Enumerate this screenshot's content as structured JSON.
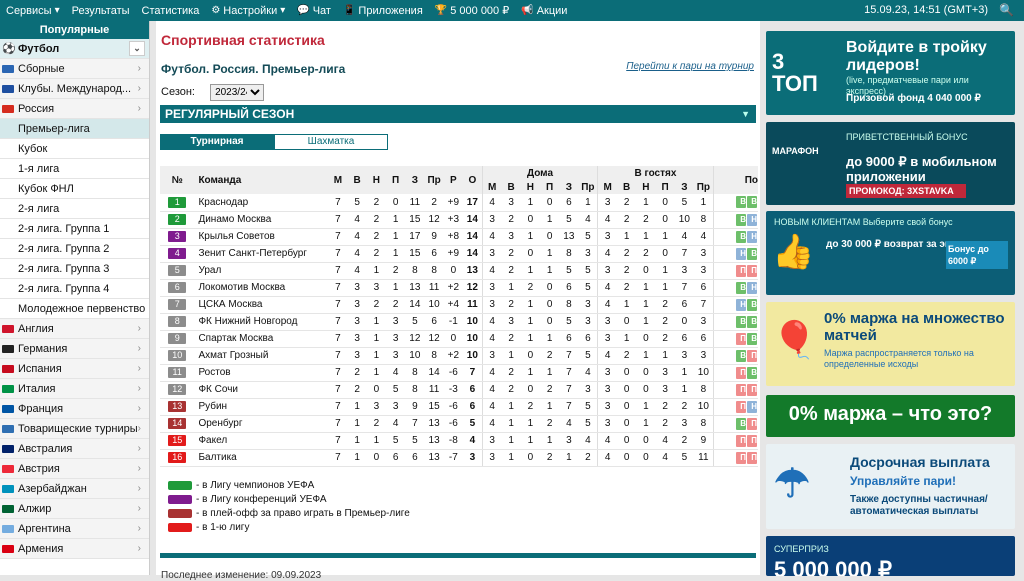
{
  "topbar": {
    "items": [
      {
        "label": "Сервисы",
        "icon": "",
        "dd": true
      },
      {
        "label": "Результаты",
        "icon": ""
      },
      {
        "label": "Статистика",
        "icon": ""
      },
      {
        "label": "Настройки",
        "icon": "gear",
        "dd": true
      },
      {
        "label": "Чат",
        "icon": "chat"
      },
      {
        "label": "Приложения",
        "icon": "phone"
      },
      {
        "label": "5 000 000 ₽",
        "icon": "trophy"
      },
      {
        "label": "Акции",
        "icon": "megaphone"
      }
    ],
    "datetime": "15.09.23, 14:51 (GMT+3)"
  },
  "sidebar": {
    "header": "Популярные",
    "items": [
      {
        "label": "Футбол",
        "type": "top",
        "sel": true,
        "flag": "ball"
      },
      {
        "label": "Сборные",
        "type": "top",
        "flag": "#2b66b3"
      },
      {
        "label": "Клубы. Международ...",
        "type": "top",
        "flag": "#1e4fa0"
      },
      {
        "label": "Россия",
        "type": "top",
        "flag": "#d52b1e"
      },
      {
        "label": "Премьер-лига",
        "type": "sub",
        "sel": true
      },
      {
        "label": "Кубок",
        "type": "sub"
      },
      {
        "label": "1-я лига",
        "type": "sub"
      },
      {
        "label": "Кубок ФНЛ",
        "type": "sub"
      },
      {
        "label": "2-я лига",
        "type": "sub"
      },
      {
        "label": "2-я лига. Группа 1",
        "type": "sub"
      },
      {
        "label": "2-я лига. Группа 2",
        "type": "sub"
      },
      {
        "label": "2-я лига. Группа 3",
        "type": "sub"
      },
      {
        "label": "2-я лига. Группа 4",
        "type": "sub"
      },
      {
        "label": "Молодежное первенство",
        "type": "sub"
      },
      {
        "label": "Англия",
        "type": "top",
        "flag": "#cf142b"
      },
      {
        "label": "Германия",
        "type": "top",
        "flag": "#222"
      },
      {
        "label": "Испания",
        "type": "top",
        "flag": "#c60b1e"
      },
      {
        "label": "Италия",
        "type": "top",
        "flag": "#009246"
      },
      {
        "label": "Франция",
        "type": "top",
        "flag": "#0055a4"
      },
      {
        "label": "Товарищеские турниры",
        "type": "top",
        "flag": "#2f6fb2"
      },
      {
        "label": "Австралия",
        "type": "top",
        "flag": "#012169"
      },
      {
        "label": "Австрия",
        "type": "top",
        "flag": "#ed2939"
      },
      {
        "label": "Азербайджан",
        "type": "top",
        "flag": "#0092bc"
      },
      {
        "label": "Алжир",
        "type": "top",
        "flag": "#006233"
      },
      {
        "label": "Аргентина",
        "type": "top",
        "flag": "#74acdf"
      },
      {
        "label": "Армения",
        "type": "top",
        "flag": "#d90012"
      }
    ]
  },
  "main": {
    "title": "Спортивная статистика",
    "subtitle": "Футбол. Россия. Премьер-лига",
    "link": "Перейти к пари на турнир",
    "season_label": "Сезон:",
    "season_value": "2023/24",
    "band": "РЕГУЛЯРНЫЙ СЕЗОН",
    "tabs": [
      "Турнирная таблица",
      "Шахматка"
    ],
    "headers": {
      "no": "№",
      "team": "Команда",
      "cols": [
        "М",
        "В",
        "Н",
        "П",
        "З",
        "Пр",
        "Р",
        "О"
      ],
      "home": "Дома",
      "away": "В гостях",
      "sub": [
        "М",
        "В",
        "Н",
        "П",
        "З",
        "Пр"
      ],
      "form": "По"
    },
    "rows": [
      {
        "n": "1",
        "c": "g",
        "team": "Краснодар",
        "s": [
          "7",
          "5",
          "2",
          "0",
          "11",
          "2",
          "+9",
          "17"
        ],
        "h": [
          "4",
          "3",
          "1",
          "0",
          "6",
          "1"
        ],
        "a": [
          "3",
          "2",
          "1",
          "0",
          "5",
          "1"
        ],
        "f": [
          "В",
          "В"
        ]
      },
      {
        "n": "2",
        "c": "g",
        "team": "Динамо Москва",
        "s": [
          "7",
          "4",
          "2",
          "1",
          "15",
          "12",
          "+3",
          "14"
        ],
        "h": [
          "3",
          "2",
          "0",
          "1",
          "5",
          "4"
        ],
        "a": [
          "4",
          "2",
          "2",
          "0",
          "10",
          "8"
        ],
        "f": [
          "В",
          "Н"
        ]
      },
      {
        "n": "3",
        "c": "v",
        "team": "Крылья Советов",
        "s": [
          "7",
          "4",
          "2",
          "1",
          "17",
          "9",
          "+8",
          "14"
        ],
        "h": [
          "4",
          "3",
          "1",
          "0",
          "13",
          "5"
        ],
        "a": [
          "3",
          "1",
          "1",
          "1",
          "4",
          "4"
        ],
        "f": [
          "В",
          "Н"
        ]
      },
      {
        "n": "4",
        "c": "v",
        "team": "Зенит Санкт-Петербург",
        "s": [
          "7",
          "4",
          "2",
          "1",
          "15",
          "6",
          "+9",
          "14"
        ],
        "h": [
          "3",
          "2",
          "0",
          "1",
          "8",
          "3"
        ],
        "a": [
          "4",
          "2",
          "2",
          "0",
          "7",
          "3"
        ],
        "f": [
          "Н",
          "В"
        ]
      },
      {
        "n": "5",
        "c": "gr",
        "team": "Урал",
        "s": [
          "7",
          "4",
          "1",
          "2",
          "8",
          "8",
          "0",
          "13"
        ],
        "h": [
          "4",
          "2",
          "1",
          "1",
          "5",
          "5"
        ],
        "a": [
          "3",
          "2",
          "0",
          "1",
          "3",
          "3"
        ],
        "f": [
          "П",
          "П"
        ]
      },
      {
        "n": "6",
        "c": "gr",
        "team": "Локомотив Москва",
        "s": [
          "7",
          "3",
          "3",
          "1",
          "13",
          "11",
          "+2",
          "12"
        ],
        "h": [
          "3",
          "1",
          "2",
          "0",
          "6",
          "5"
        ],
        "a": [
          "4",
          "2",
          "1",
          "1",
          "7",
          "6"
        ],
        "f": [
          "В",
          "Н"
        ]
      },
      {
        "n": "7",
        "c": "gr",
        "team": "ЦСКА Москва",
        "s": [
          "7",
          "3",
          "2",
          "2",
          "14",
          "10",
          "+4",
          "11"
        ],
        "h": [
          "3",
          "2",
          "1",
          "0",
          "8",
          "3"
        ],
        "a": [
          "4",
          "1",
          "1",
          "2",
          "6",
          "7"
        ],
        "f": [
          "Н",
          "В"
        ]
      },
      {
        "n": "8",
        "c": "gr",
        "team": "ФК Нижний Новгород",
        "s": [
          "7",
          "3",
          "1",
          "3",
          "5",
          "6",
          "-1",
          "10"
        ],
        "h": [
          "4",
          "3",
          "1",
          "0",
          "5",
          "3"
        ],
        "a": [
          "3",
          "0",
          "1",
          "2",
          "0",
          "3"
        ],
        "f": [
          "В",
          "В"
        ]
      },
      {
        "n": "9",
        "c": "gr",
        "team": "Спартак Москва",
        "s": [
          "7",
          "3",
          "1",
          "3",
          "12",
          "12",
          "0",
          "10"
        ],
        "h": [
          "4",
          "2",
          "1",
          "1",
          "6",
          "6"
        ],
        "a": [
          "3",
          "1",
          "0",
          "2",
          "6",
          "6"
        ],
        "f": [
          "П",
          "В"
        ]
      },
      {
        "n": "10",
        "c": "gr",
        "team": "Ахмат Грозный",
        "s": [
          "7",
          "3",
          "1",
          "3",
          "10",
          "8",
          "+2",
          "10"
        ],
        "h": [
          "3",
          "1",
          "0",
          "2",
          "7",
          "5"
        ],
        "a": [
          "4",
          "2",
          "1",
          "1",
          "3",
          "3"
        ],
        "f": [
          "В",
          "П"
        ]
      },
      {
        "n": "11",
        "c": "gr",
        "team": "Ростов",
        "s": [
          "7",
          "2",
          "1",
          "4",
          "8",
          "14",
          "-6",
          "7"
        ],
        "h": [
          "4",
          "2",
          "1",
          "1",
          "7",
          "4"
        ],
        "a": [
          "3",
          "0",
          "0",
          "3",
          "1",
          "10"
        ],
        "f": [
          "П",
          "В"
        ]
      },
      {
        "n": "12",
        "c": "gr",
        "team": "ФК Сочи",
        "s": [
          "7",
          "2",
          "0",
          "5",
          "8",
          "11",
          "-3",
          "6"
        ],
        "h": [
          "4",
          "2",
          "0",
          "2",
          "7",
          "3"
        ],
        "a": [
          "3",
          "0",
          "0",
          "3",
          "1",
          "8"
        ],
        "f": [
          "П",
          "П"
        ]
      },
      {
        "n": "13",
        "c": "r",
        "team": "Рубин",
        "s": [
          "7",
          "1",
          "3",
          "3",
          "9",
          "15",
          "-6",
          "6"
        ],
        "h": [
          "4",
          "1",
          "2",
          "1",
          "7",
          "5"
        ],
        "a": [
          "3",
          "0",
          "1",
          "2",
          "2",
          "10"
        ],
        "f": [
          "П",
          "Н"
        ]
      },
      {
        "n": "14",
        "c": "r",
        "team": "Оренбург",
        "s": [
          "7",
          "1",
          "2",
          "4",
          "7",
          "13",
          "-6",
          "5"
        ],
        "h": [
          "4",
          "1",
          "1",
          "2",
          "4",
          "5"
        ],
        "a": [
          "3",
          "0",
          "1",
          "2",
          "3",
          "8"
        ],
        "f": [
          "В",
          "П"
        ]
      },
      {
        "n": "15",
        "c": "red",
        "team": "Факел",
        "s": [
          "7",
          "1",
          "1",
          "5",
          "5",
          "13",
          "-8",
          "4"
        ],
        "h": [
          "3",
          "1",
          "1",
          "1",
          "3",
          "4"
        ],
        "a": [
          "4",
          "0",
          "0",
          "4",
          "2",
          "9"
        ],
        "f": [
          "П",
          "П"
        ]
      },
      {
        "n": "16",
        "c": "red",
        "team": "Балтика",
        "s": [
          "7",
          "1",
          "0",
          "6",
          "6",
          "13",
          "-7",
          "3"
        ],
        "h": [
          "3",
          "1",
          "0",
          "2",
          "1",
          "2"
        ],
        "a": [
          "4",
          "0",
          "0",
          "4",
          "5",
          "11"
        ],
        "f": [
          "П",
          "П"
        ]
      }
    ],
    "legend": [
      {
        "color": "#1f9a3a",
        "text": "- в Лигу чемпионов УЕФА"
      },
      {
        "color": "#7f1b8e",
        "text": "- в Лигу конференций УЕФА"
      },
      {
        "color": "#a83232",
        "text": "- в плей-офф за право играть в Премьер-лиге"
      },
      {
        "color": "#e21b1b",
        "text": "- в 1-ю лигу"
      }
    ],
    "bottom_text": "Последнее изменение: 09.09.2023"
  },
  "ads": [
    {
      "t1": "Войдите в тройку лидеров!",
      "t2": "(live, предматчевые пари или экспресс)",
      "t3": "Призовой фонд 4 040 000 ₽",
      "badge": "3 ТОП",
      "bg": "#0b6d78"
    },
    {
      "t1": "до 9000 ₽ в мобильном приложении",
      "t2": "ПРИВЕТСТВЕННЫЙ БОНУС",
      "t3": "ПРОМОКОД: 3XSTAVKA",
      "badge": "МАРАФОН",
      "bg": "#0a4a5b"
    },
    {
      "t1": "до 30 000 ₽ возврат за экспрессы",
      "t2": "НОВЫМ КЛИЕНТАМ   Выберите свой бонус",
      "t3": "Бонус до 6000 ₽",
      "badge": "",
      "bg": "#0c5e76"
    },
    {
      "t1": "0% маржа на множество матчей",
      "t2": "Маржа распространяется только на определенные исходы",
      "t3": "",
      "badge": "",
      "bg": "#f2e9a0"
    },
    {
      "t1": "0% маржа – что это?",
      "t2": "",
      "t3": "",
      "badge": "",
      "bg": "#137a2a"
    },
    {
      "t1": "Досрочная выплата",
      "t2": "Управляйте пари!",
      "t3": "Также доступны частичная/ автоматическая выплаты",
      "badge": "",
      "bg": "#e9f1f4"
    },
    {
      "t1": "5 000 000 ₽",
      "t2": "СУПЕРПРИЗ",
      "t3": "",
      "badge": "",
      "bg": "#0a3f77"
    }
  ]
}
